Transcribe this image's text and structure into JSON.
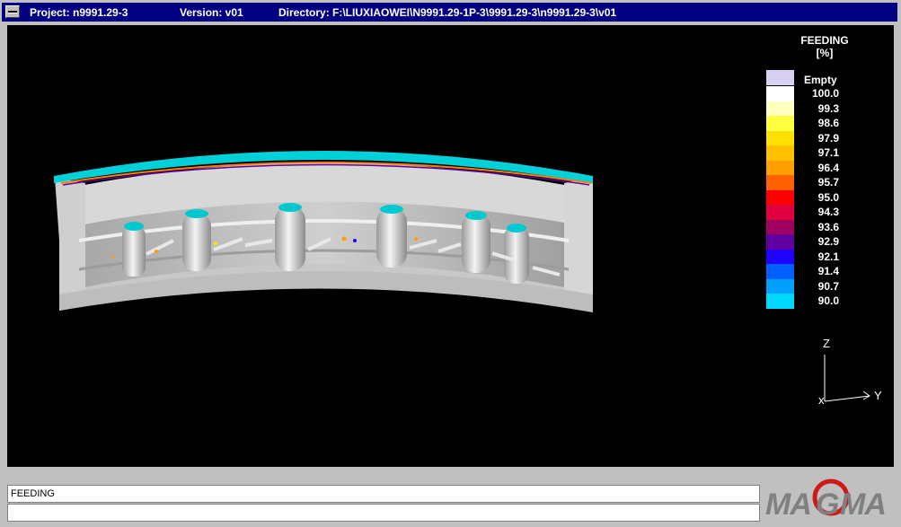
{
  "window": {
    "project": "Project: n9991.29-3",
    "version": "Version: v01",
    "directory": "Directory: F:\\LIUXIAOWEI\\N9991.29-1P-3\\9991.29-3\\n9991.29-3\\v01"
  },
  "legend": {
    "title": "FEEDING",
    "unit": "[%]",
    "empty_label": "Empty",
    "empty_color": "#d8d0f0",
    "entries": [
      {
        "value": "100.0",
        "color": "#ffffff"
      },
      {
        "value": "99.3",
        "color": "#ffffc0"
      },
      {
        "value": "98.6",
        "color": "#ffff40"
      },
      {
        "value": "97.9",
        "color": "#ffe000"
      },
      {
        "value": "97.1",
        "color": "#ffc000"
      },
      {
        "value": "96.4",
        "color": "#ffa000"
      },
      {
        "value": "95.7",
        "color": "#ff6000"
      },
      {
        "value": "95.0",
        "color": "#ff0000"
      },
      {
        "value": "94.3",
        "color": "#e00040"
      },
      {
        "value": "93.6",
        "color": "#a00060"
      },
      {
        "value": "92.9",
        "color": "#6000a0"
      },
      {
        "value": "92.1",
        "color": "#2000ff"
      },
      {
        "value": "91.4",
        "color": "#0060ff"
      },
      {
        "value": "90.7",
        "color": "#00a0ff"
      },
      {
        "value": "90.0",
        "color": "#00d8ff"
      }
    ]
  },
  "axes": {
    "z": "Z",
    "y": "Y",
    "x": "x"
  },
  "status": {
    "line1": "FEEDING",
    "line2": ""
  },
  "brand": {
    "logo": "MAGMA",
    "accent": "#d01818"
  }
}
